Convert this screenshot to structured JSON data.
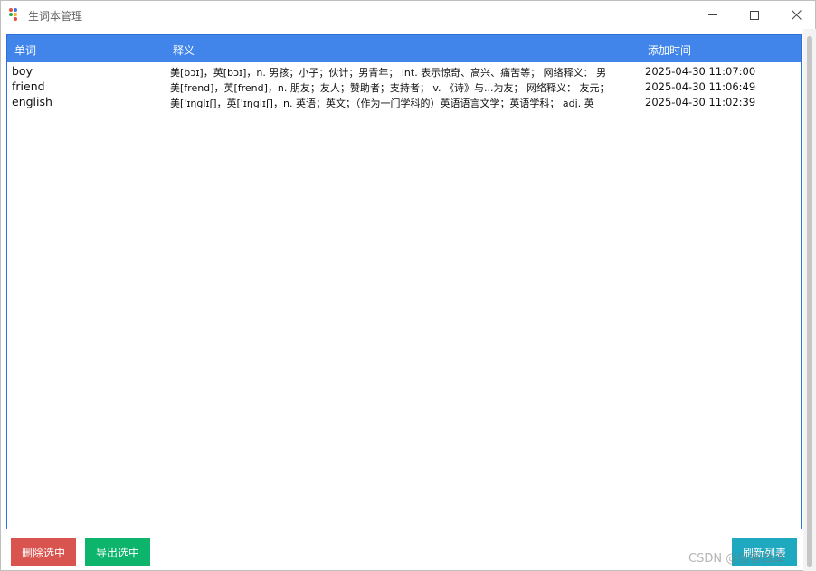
{
  "window": {
    "title": "生词本管理",
    "icon": "app-dots-icon",
    "controls": [
      "minimize-icon",
      "maximize-icon",
      "close-icon"
    ]
  },
  "table": {
    "headers": {
      "word": "单词",
      "definition": "释义",
      "added_time": "添加时间"
    },
    "rows": [
      {
        "word": "boy",
        "definition": "美[bɔɪ]，英[bɔɪ]，n. 男孩；小子；伙计；男青年； int. 表示惊奇、高兴、痛苦等； 网络释义： 男",
        "added_time": "2025-04-30 11:07:00"
      },
      {
        "word": "friend",
        "definition": "美[frend]，英[frend]，n. 朋友；友人；赞助者；支持者； v. 《诗》与...为友； 网络释义： 友元；",
        "added_time": "2025-04-30 11:06:49"
      },
      {
        "word": "english",
        "definition": "美['ɪŋglɪʃ]，英['ɪŋglɪʃ]，n. 英语；英文；（作为一门学科的）英语语言文学；英语学科； adj. 英",
        "added_time": "2025-04-30 11:02:39"
      }
    ]
  },
  "buttons": {
    "delete": "删除选中",
    "export": "导出选中",
    "refresh": "刷新列表"
  },
  "watermark": "CSDN @创客白泽",
  "colors": {
    "header_bg": "#4185ea",
    "delete_bg": "#d9534f",
    "export_bg": "#0cb46c",
    "refresh_bg": "#1fa9c1"
  }
}
